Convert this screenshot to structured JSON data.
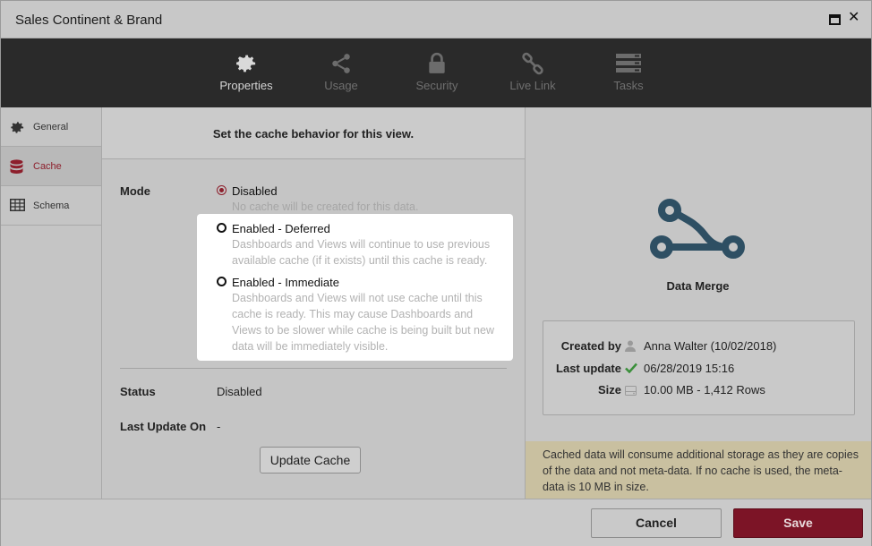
{
  "window": {
    "title": "Sales Continent & Brand",
    "maximize_icon": "maximize-icon",
    "close_symbol": "✕"
  },
  "toolbar": {
    "items": [
      {
        "label": "Properties",
        "icon": "gear-icon",
        "active": true
      },
      {
        "label": "Usage",
        "icon": "share-icon",
        "active": false
      },
      {
        "label": "Security",
        "icon": "lock-icon",
        "active": false
      },
      {
        "label": "Live Link",
        "icon": "link-icon",
        "active": false
      },
      {
        "label": "Tasks",
        "icon": "tasks-icon",
        "active": false
      }
    ]
  },
  "sidebar": {
    "items": [
      {
        "label": "General",
        "icon": "gear-icon",
        "active": false
      },
      {
        "label": "Cache",
        "icon": "database-icon",
        "active": true
      },
      {
        "label": "Schema",
        "icon": "table-icon",
        "active": false
      }
    ]
  },
  "main": {
    "header": "Set the cache behavior for this view.",
    "mode_label": "Mode",
    "options": [
      {
        "title": "Disabled",
        "desc": "No cache will be created for this data.",
        "selected": true
      },
      {
        "title": "Enabled - Deferred",
        "desc": "Dashboards and Views will continue to use previous available cache (if it exists) until this cache is ready.",
        "selected": false
      },
      {
        "title": "Enabled - Immediate",
        "desc": "Dashboards and Views will not use cache until this cache is ready. This may cause Dashboards and Views to be slower while cache is being built but new data will be immediately visible.",
        "selected": false
      }
    ],
    "status_label": "Status",
    "status_value": "Disabled",
    "last_update_label": "Last Update On",
    "last_update_value": "-",
    "update_button": "Update Cache"
  },
  "details": {
    "icon": "data-merge-icon",
    "name": "Data Merge",
    "created_by_label": "Created by",
    "created_by_value": "Anna Walter (10/02/2018)",
    "last_update_label": "Last update",
    "last_update_value": "06/28/2019 15:16",
    "size_label": "Size",
    "size_value": "10.00 MB - 1,412 Rows",
    "note": "Cached data will consume additional storage as they are copies of the data and not meta-data. If no cache is used, the meta-data is 10 MB in size.",
    "colors": {
      "icon": "#2e4f63",
      "check": "#3a8f3a",
      "accent": "#8d1f2c"
    }
  },
  "footer": {
    "cancel": "Cancel",
    "save": "Save"
  }
}
